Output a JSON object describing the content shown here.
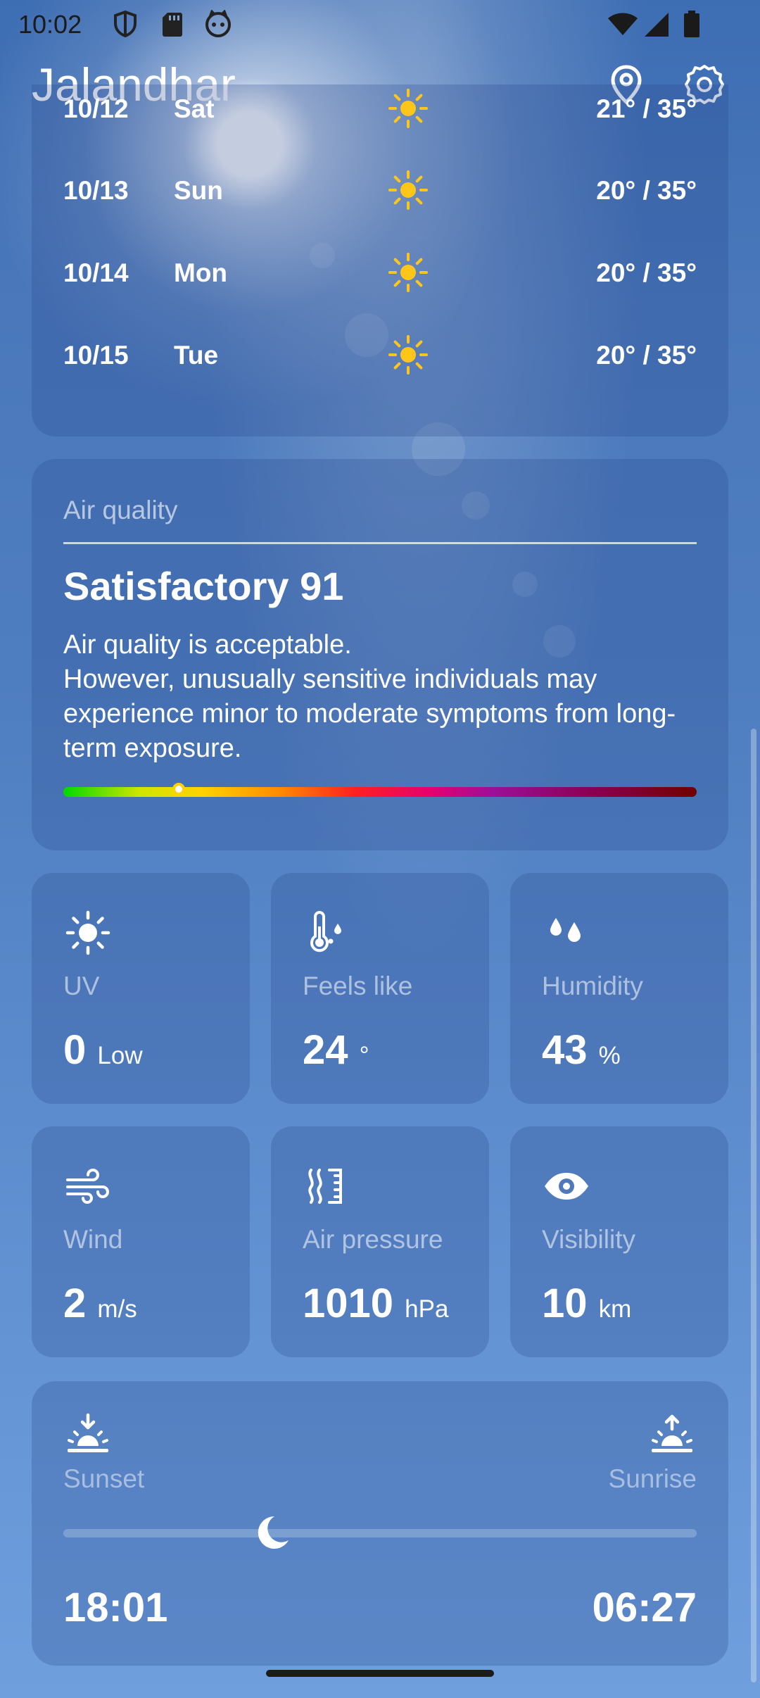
{
  "status_bar": {
    "time": "10:02"
  },
  "header": {
    "city": "Jalandhar"
  },
  "forecast": [
    {
      "date": "10/12",
      "day": "Sat",
      "temp": "21° / 35°"
    },
    {
      "date": "10/13",
      "day": "Sun",
      "temp": "20° / 35°"
    },
    {
      "date": "10/14",
      "day": "Mon",
      "temp": "20° / 35°"
    },
    {
      "date": "10/15",
      "day": "Tue",
      "temp": "20° / 35°"
    }
  ],
  "air_quality": {
    "title": "Air quality",
    "level": "Satisfactory 91",
    "line1": "Air quality is acceptable.",
    "line2": "However, unusually sensitive individuals may experience minor to moderate symptoms from long-term exposure.",
    "index_fraction": 0.182
  },
  "tiles": {
    "uv": {
      "label": "UV",
      "value": "0",
      "unit": "Low"
    },
    "feels_like": {
      "label": "Feels like",
      "value": "24",
      "unit": "°"
    },
    "humidity": {
      "label": "Humidity",
      "value": "43",
      "unit": "%"
    },
    "wind": {
      "label": "Wind",
      "value": "2",
      "unit": "m/s"
    },
    "pressure": {
      "label": "Air pressure",
      "value": "1010",
      "unit": "hPa"
    },
    "visibility": {
      "label": "Visibility",
      "value": "10",
      "unit": "km"
    }
  },
  "sun": {
    "sunset_label": "Sunset",
    "sunrise_label": "Sunrise",
    "sunset_time": "18:01",
    "sunrise_time": "06:27",
    "progress_fraction": 0.33
  },
  "colors": {
    "sun_yellow": "#ffc61a",
    "text": "#ffffff"
  }
}
